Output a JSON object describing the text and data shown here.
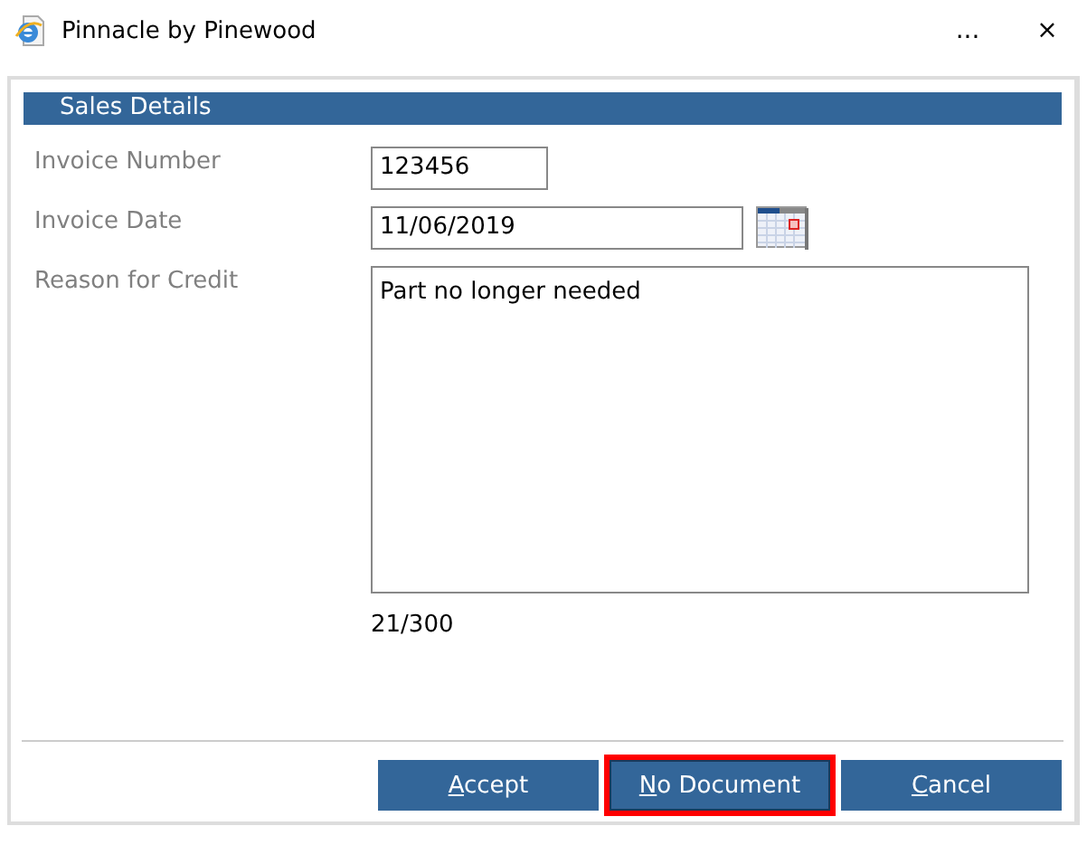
{
  "window": {
    "title": "Pinnacle by Pinewood",
    "controls": [
      "...",
      "×"
    ]
  },
  "section": {
    "title": "Sales Details"
  },
  "fields": [
    {
      "kind": "text",
      "label": "Invoice Number",
      "value": "123456"
    },
    {
      "kind": "date",
      "label": "Invoice Date",
      "value": "11/06/2019"
    },
    {
      "kind": "textarea",
      "label": "Reason for Credit",
      "value": "Part no longer needed",
      "counter": "21/300"
    }
  ],
  "buttons": [
    {
      "parts": [
        {
          "text": "A",
          "underlined": true
        },
        {
          "text": "ccept",
          "underlined": false
        }
      ],
      "focused": false
    },
    {
      "parts": [
        {
          "text": "N",
          "underlined": true
        },
        {
          "text": "o Document",
          "underlined": false
        }
      ],
      "focused": true
    },
    {
      "parts": [
        {
          "text": "C",
          "underlined": true
        },
        {
          "text": "ancel",
          "underlined": false
        }
      ],
      "focused": false
    }
  ]
}
